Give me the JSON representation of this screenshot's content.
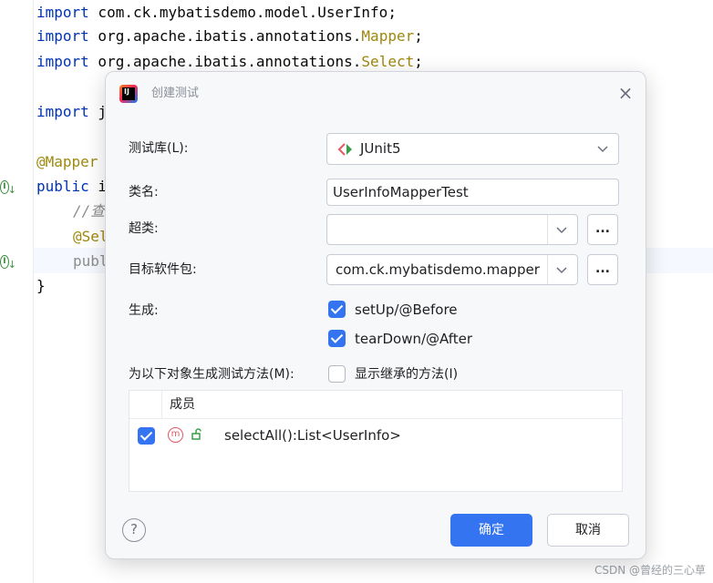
{
  "editor": {
    "lines": [
      {
        "kw": "import",
        "rest": " com.ck.mybatisdemo.model.UserInfo;"
      },
      {
        "kw": "import",
        "rest": " org.apache.ibatis.annotations.",
        "ann": "Mapper",
        "tail": ";"
      },
      {
        "kw": "import",
        "rest": " org.apache.ibatis.annotations.",
        "ann": "Select",
        "tail": ";"
      },
      {
        "kw": "import",
        "rest": " j"
      },
      {
        "ann": "@Mapper"
      },
      {
        "kw": "public",
        "rest": " i"
      },
      {
        "cmt": "//查"
      },
      {
        "ann": "@Sel"
      },
      {
        "rest": "publ"
      },
      {
        "rest": "}"
      }
    ],
    "gutter_icon": "implementations-gutter-icon"
  },
  "dialog": {
    "title": "创建测试",
    "app_icon": "intellij-idea-icon",
    "close_icon": "close-icon",
    "test_library": {
      "label": "测试库(L):",
      "value": "JUnit5",
      "icon": "junit5-icon"
    },
    "class_name": {
      "label": "类名:",
      "value": "UserInfoMapperTest"
    },
    "superclass": {
      "label": "超类:",
      "value": "",
      "more": "..."
    },
    "target_package": {
      "label": "目标软件包:",
      "value": "com.ck.mybatisdemo.mapper",
      "more": "..."
    },
    "generate": {
      "label": "生成:",
      "options": [
        {
          "label": "setUp/@Before",
          "checked": true
        },
        {
          "label": "tearDown/@After",
          "checked": true
        }
      ]
    },
    "methods_for": {
      "label": "为以下对象生成测试方法(M):",
      "inherited_label": "显示继承的方法(I)",
      "inherited_checked": false
    },
    "members_table": {
      "header": "成员",
      "rows": [
        {
          "checked": true,
          "icon": "method-icon",
          "visibility_icon": "public-lock-icon",
          "text": "selectAll():List<UserInfo>"
        }
      ]
    },
    "help": "?",
    "ok_label": "确定",
    "cancel_label": "取消"
  },
  "watermark": "CSDN @曾经的三心草",
  "colors": {
    "accent": "#3574f0",
    "keyword": "#0033b3",
    "annotation": "#9e880d"
  }
}
